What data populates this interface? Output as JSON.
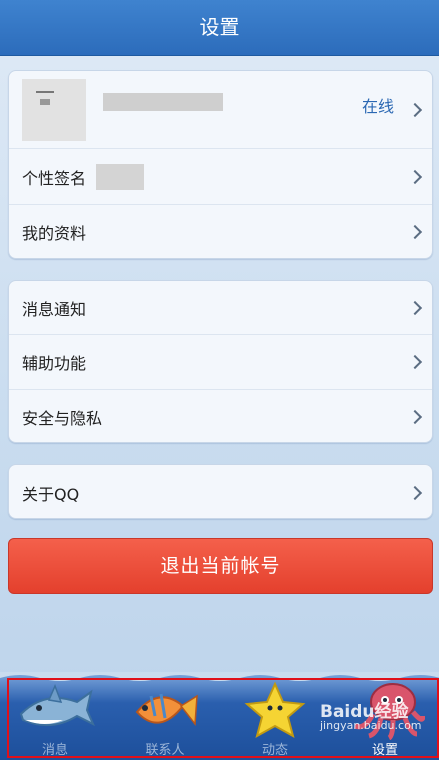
{
  "header": {
    "title": "设置"
  },
  "profile": {
    "status": "在线"
  },
  "groups": {
    "account": {
      "signature_label": "个性签名",
      "profile_label": "我的资料"
    },
    "general": {
      "items": [
        "消息通知",
        "辅助功能",
        "安全与隐私"
      ]
    },
    "about": {
      "label": "关于QQ"
    }
  },
  "logout": {
    "label": "退出当前帐号"
  },
  "tabs": [
    {
      "label": "消息",
      "icon": "shark-icon",
      "active": false
    },
    {
      "label": "联系人",
      "icon": "fish-icon",
      "active": false
    },
    {
      "label": "动态",
      "icon": "starfish-icon",
      "active": false
    },
    {
      "label": "设置",
      "icon": "octopus-icon",
      "active": true
    }
  ],
  "watermark": {
    "brand": "Baidu经验",
    "url": "jingyan.baidu.com"
  },
  "colors": {
    "header": "#2f72c2",
    "logout": "#ea4834",
    "accent_text": "#2b68b3"
  }
}
